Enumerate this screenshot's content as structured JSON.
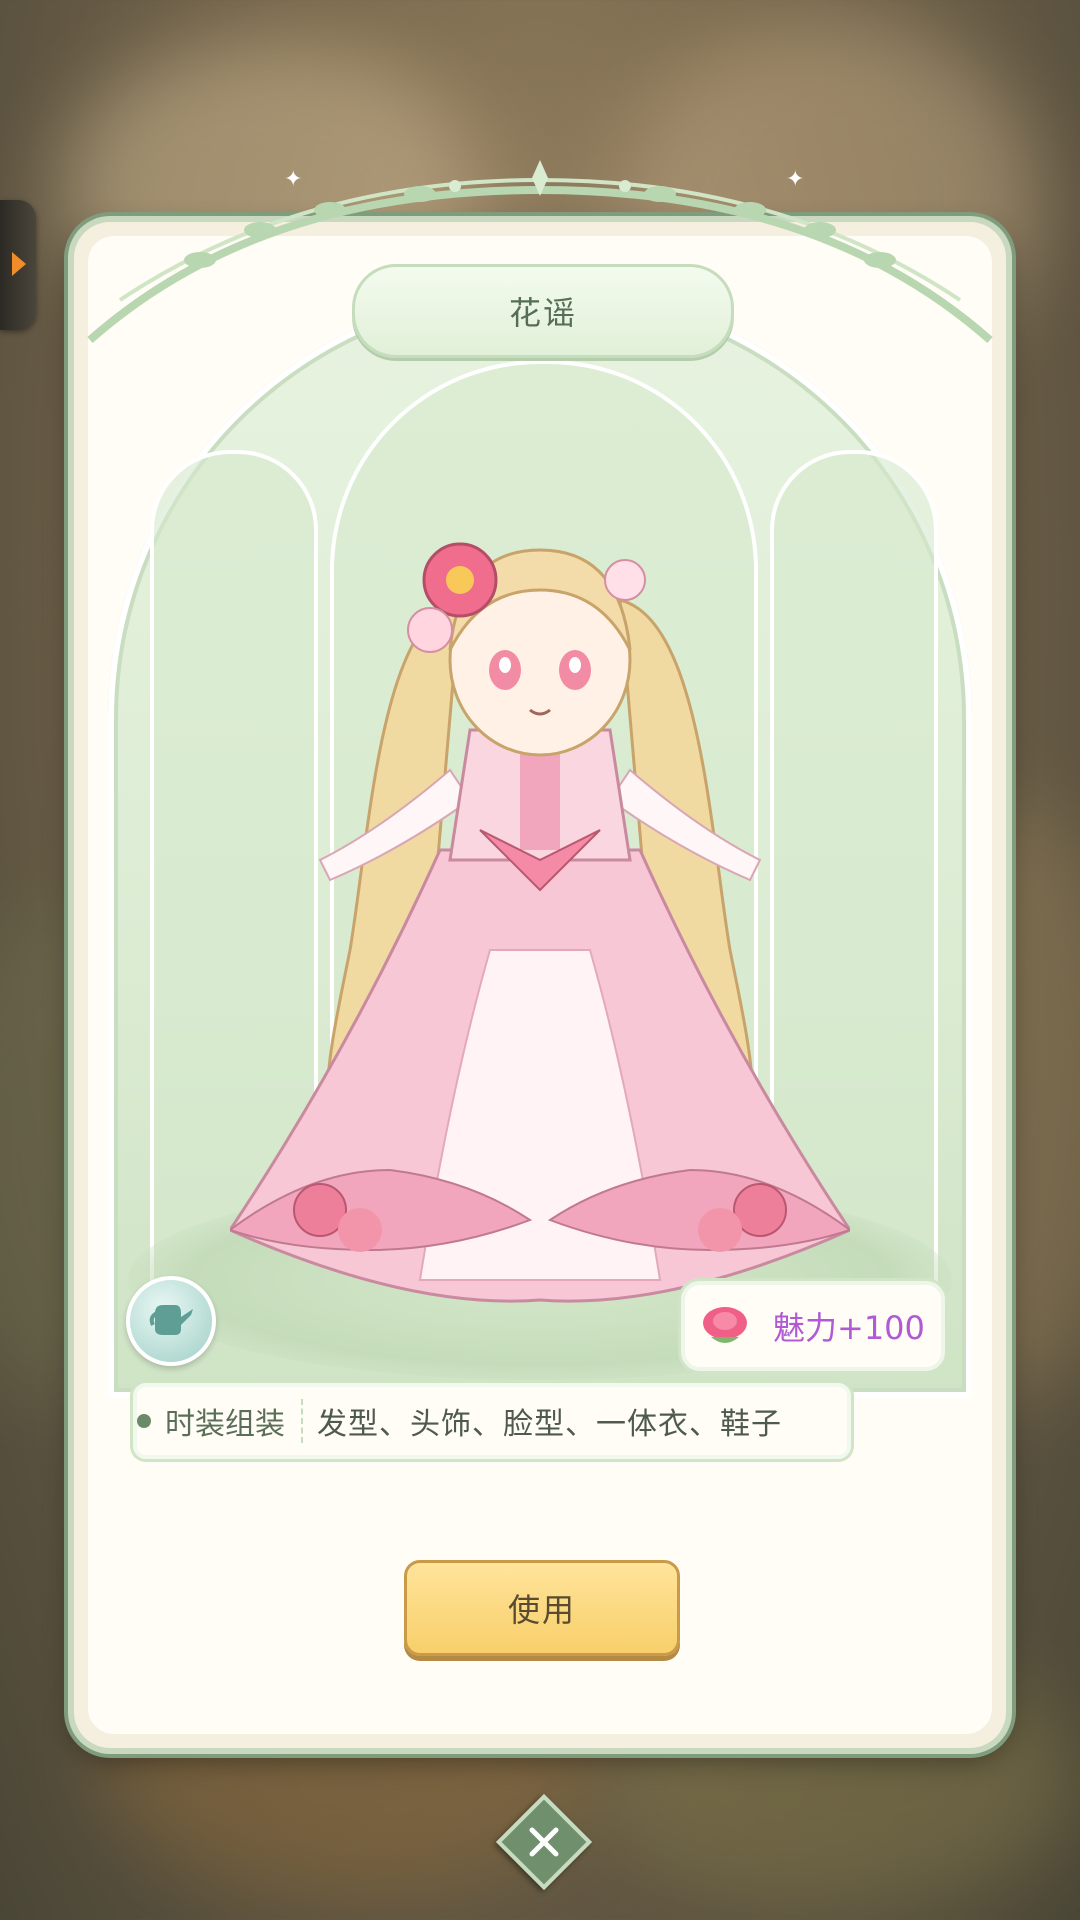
{
  "outfit": {
    "title": "花谣",
    "charm_text": "魅力+100",
    "set_label": "时装组装",
    "set_parts": "发型、头饰、脸型、一体衣、鞋子"
  },
  "actions": {
    "use_label": "使用"
  },
  "colors": {
    "accent_green": "#6f8f6d",
    "button_yellow": "#f8cf6a",
    "charm_purple": "#b05ad6"
  },
  "icons": {
    "side_tab": "chevron-right-icon",
    "wand": "watering-can-icon",
    "charm": "rose-icon",
    "close": "close-icon"
  }
}
